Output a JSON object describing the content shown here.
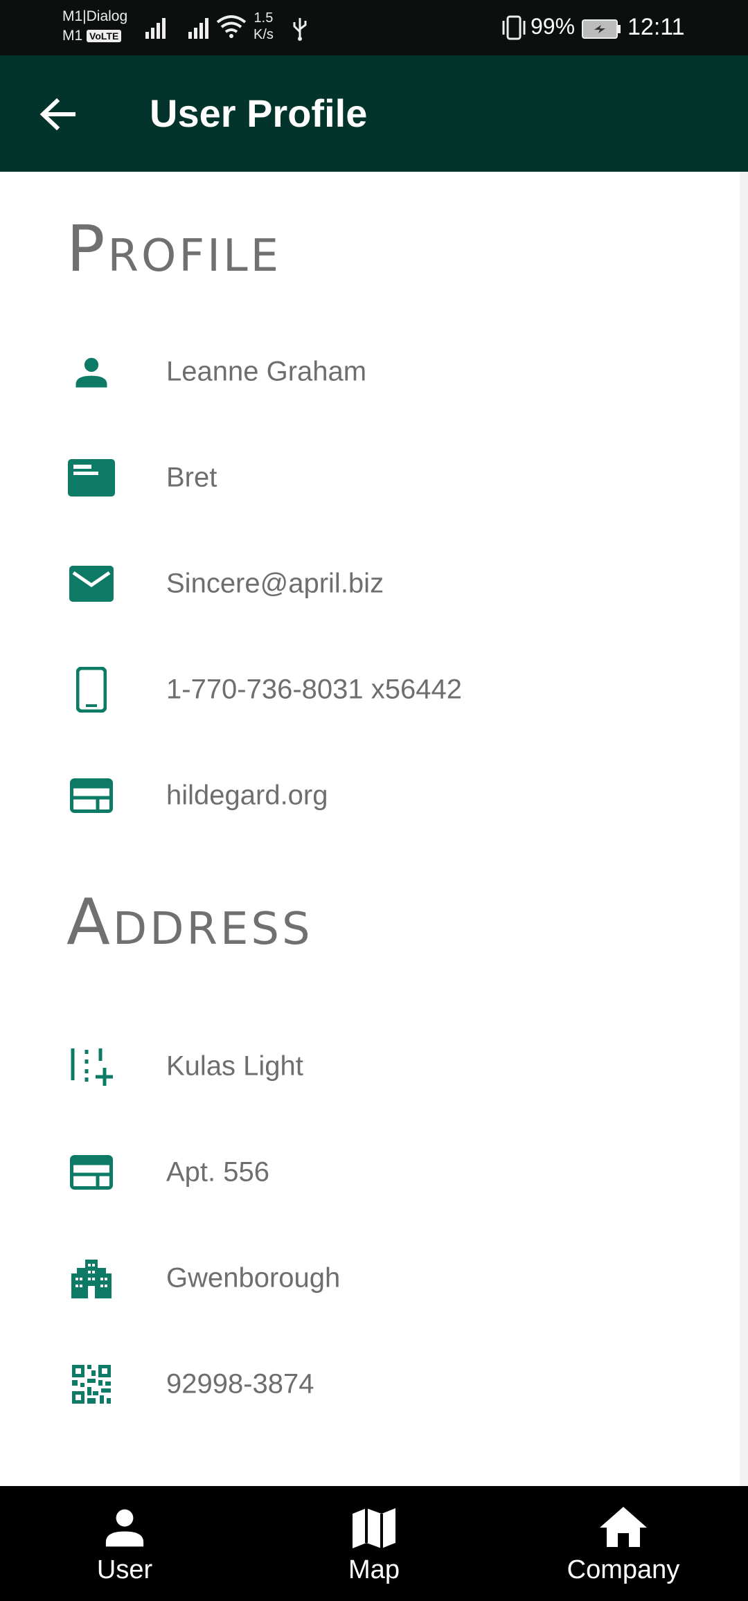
{
  "status_bar": {
    "carrier_line1": "M1|Dialog",
    "carrier_line2": "M1",
    "volte": "VoLTE",
    "speed_value": "1.5",
    "speed_unit": "K/s",
    "battery": "99%",
    "time": "12:11"
  },
  "app_bar": {
    "title": "User Profile",
    "back_icon": "arrow-back-icon"
  },
  "colors": {
    "app_bar": "#03342b",
    "accent": "#0d7a66",
    "text": "#6e6e6e",
    "heading": "#707070"
  },
  "profile": {
    "heading": "Profile",
    "items": [
      {
        "icon": "person-icon",
        "value": "Leanne Graham"
      },
      {
        "icon": "id-card-icon",
        "value": "Bret"
      },
      {
        "icon": "mail-icon",
        "value": "Sincere@april.biz"
      },
      {
        "icon": "phone-icon",
        "value": "1-770-736-8031 x56442"
      },
      {
        "icon": "web-icon",
        "value": "hildegard.org"
      }
    ]
  },
  "address": {
    "heading": "Address",
    "items": [
      {
        "icon": "street-icon",
        "value": "Kulas Light"
      },
      {
        "icon": "web-icon",
        "value": "Apt. 556"
      },
      {
        "icon": "city-icon",
        "value": "Gwenborough"
      },
      {
        "icon": "qr-code-icon",
        "value": "92998-3874"
      }
    ]
  },
  "bottom_nav": {
    "items": [
      {
        "label": "User",
        "icon": "person-icon"
      },
      {
        "label": "Map",
        "icon": "map-icon"
      },
      {
        "label": "Company",
        "icon": "home-icon"
      }
    ]
  }
}
